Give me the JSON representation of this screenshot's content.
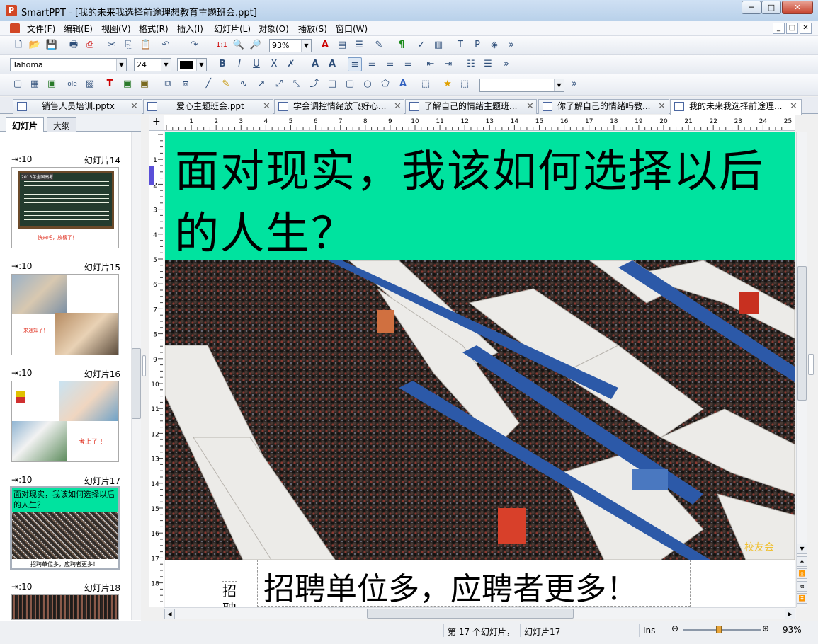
{
  "window": {
    "title": "SmartPPT - [我的未来我选择前途理想教育主题班会.ppt]",
    "app_icon_letter": "P",
    "controls": {
      "minimize": "─",
      "maximize": "□",
      "close": "✕"
    }
  },
  "menu": {
    "items": [
      "文件(F)",
      "编辑(E)",
      "视图(V)",
      "格式(R)",
      "插入(I)",
      "幻灯片(L)",
      "对象(O)",
      "播放(S)",
      "窗口(W)"
    ],
    "mdi_controls": [
      "_",
      "□",
      "✕"
    ]
  },
  "toolbar": {
    "zoom_value": "93%",
    "font_name": "Tahoma",
    "font_size": "24",
    "overflow": "»"
  },
  "tabs": [
    {
      "label": "销售人员培训.pptx",
      "active": false
    },
    {
      "label": "爱心主题班会.ppt",
      "active": false
    },
    {
      "label": "学会调控情绪放飞好心...",
      "active": false
    },
    {
      "label": "了解自己的情绪主题班...",
      "active": false
    },
    {
      "label": "你了解自己的情绪吗教...",
      "active": false
    },
    {
      "label": "我的未来我选择前途理...",
      "active": true
    }
  ],
  "tab_close_glyph": "✕",
  "left_panel": {
    "tabs": [
      "幻灯片",
      "大纲"
    ],
    "thumbnails": [
      {
        "timing": ":10",
        "label": "幻灯片14",
        "caption": "快来吧，放榜了！",
        "board_header": "2013年全国高考"
      },
      {
        "timing": ":10",
        "label": "幻灯片15",
        "caption": "来通知了！"
      },
      {
        "timing": ":10",
        "label": "幻灯片16",
        "caption": "考上了 ！"
      },
      {
        "timing": ":10",
        "label": "幻灯片17",
        "title": "面对现实，我该如何选择以后的人生？",
        "caption": "招聘单位多，应聘者更多！"
      },
      {
        "timing": ":10",
        "label": "幻灯片18"
      }
    ]
  },
  "ruler": {
    "h_labels": [
      "1",
      "2",
      "3",
      "4",
      "5",
      "6",
      "7",
      "8",
      "9",
      "10",
      "11",
      "12",
      "13",
      "14",
      "15",
      "16",
      "17",
      "18",
      "19",
      "20",
      "21",
      "22",
      "23",
      "24",
      "25"
    ],
    "v_labels": [
      "1",
      "2",
      "3",
      "4",
      "5",
      "6",
      "7",
      "8",
      "9",
      "10",
      "11",
      "12",
      "13",
      "14",
      "15",
      "16",
      "17",
      "18"
    ]
  },
  "slide": {
    "title": "面对现实，我该如何选择以后的人生？",
    "caption": "招聘单位多，应聘者更多！",
    "side_text": "招聘",
    "watermark": "校友会",
    "colors": {
      "title_bg": "#00e39f"
    }
  },
  "status": {
    "slide_position": "第 17 个幻灯片，",
    "slide_name": "幻灯片17",
    "mode": "Ins",
    "zoom": "93%",
    "zoom_level": 0.45
  }
}
